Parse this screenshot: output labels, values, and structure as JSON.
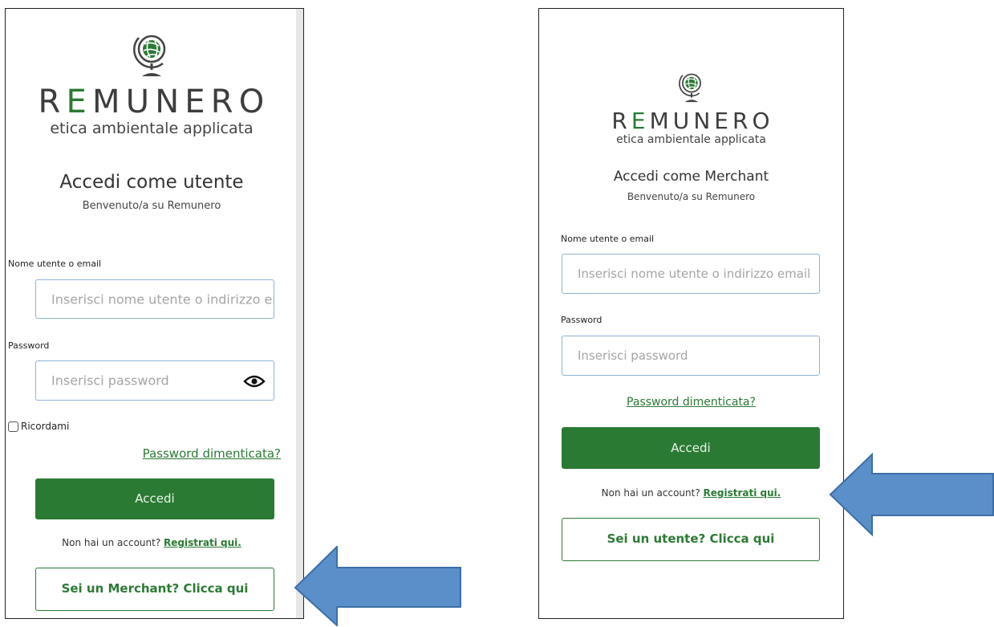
{
  "colors": {
    "brand_green": "#2b7a34",
    "arrow_blue": "#5b8fc9",
    "input_border": "#8fb2d4"
  },
  "user_login": {
    "logo": {
      "icon": "globe-icon",
      "brand_prefix": "R",
      "brand_accent": "E",
      "brand_suffix": "MUNERO",
      "tagline": "etica ambientale applicata"
    },
    "title": "Accedi come utente",
    "subtitle": "Benvenuto/a su Remunero",
    "username_label": "Nome utente o email",
    "username_placeholder": "Inserisci nome utente o indirizzo em",
    "password_label": "Password",
    "password_placeholder": "Inserisci password",
    "password_toggle_icon": "eye-icon",
    "remember_label": "Ricordami",
    "forgot_link": "Password dimenticata?",
    "submit_label": "Accedi",
    "signup_prompt": "Non hai un account?",
    "signup_link": "Registrati qui.",
    "switch_button": "Sei un Merchant? Clicca qui"
  },
  "merchant_login": {
    "logo": {
      "icon": "globe-icon",
      "brand_prefix": "R",
      "brand_accent": "E",
      "brand_suffix": "MUNERO",
      "tagline": "etica ambientale applicata"
    },
    "title": "Accedi come Merchant",
    "subtitle": "Benvenuto/a su Remunero",
    "username_label": "Nome utente o email",
    "username_placeholder": "Inserisci nome utente o indirizzo email",
    "password_label": "Password",
    "password_placeholder": "Inserisci password",
    "forgot_link": "Password dimenticata?",
    "submit_label": "Accedi",
    "signup_prompt": "Non hai un account?",
    "signup_link": "Registrati qui.",
    "switch_button": "Sei un utente? Clicca qui"
  }
}
